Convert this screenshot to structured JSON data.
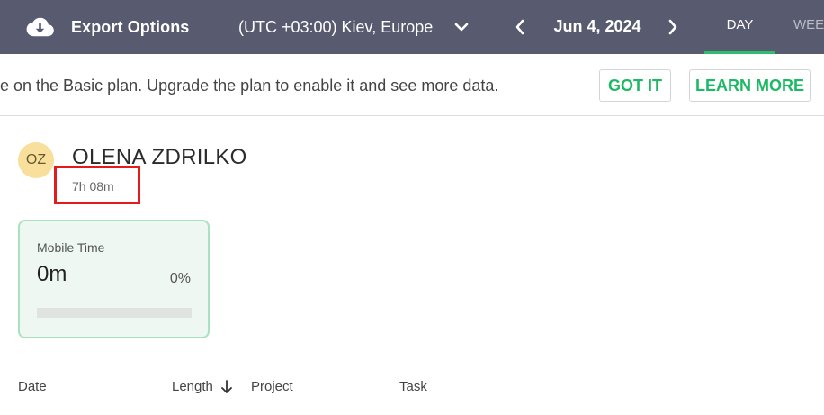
{
  "topbar": {
    "export_label": "Export Options",
    "export_icon": "cloud-download-icon",
    "timezone": "(UTC +03:00) Kiev, Europe",
    "date": "Jun 4, 2024",
    "tabs": [
      {
        "label": "DAY",
        "active": true
      },
      {
        "label": "WEEK",
        "active": false
      }
    ],
    "accent_color": "#2dbe70",
    "background_color": "#585a6f"
  },
  "banner": {
    "text": "e on the Basic plan. Upgrade the plan to enable it and see more data.",
    "got_it_label": "GOT IT",
    "learn_more_label": "LEARN MORE"
  },
  "user": {
    "initials": "OZ",
    "name": "OLENA ZDRILKO",
    "total_time": "7h 08m"
  },
  "mobile_card": {
    "title": "Mobile Time",
    "value": "0m",
    "percent": "0%",
    "progress_fraction": 0
  },
  "table": {
    "columns": [
      "Date",
      "Length",
      "Project",
      "Task"
    ]
  }
}
